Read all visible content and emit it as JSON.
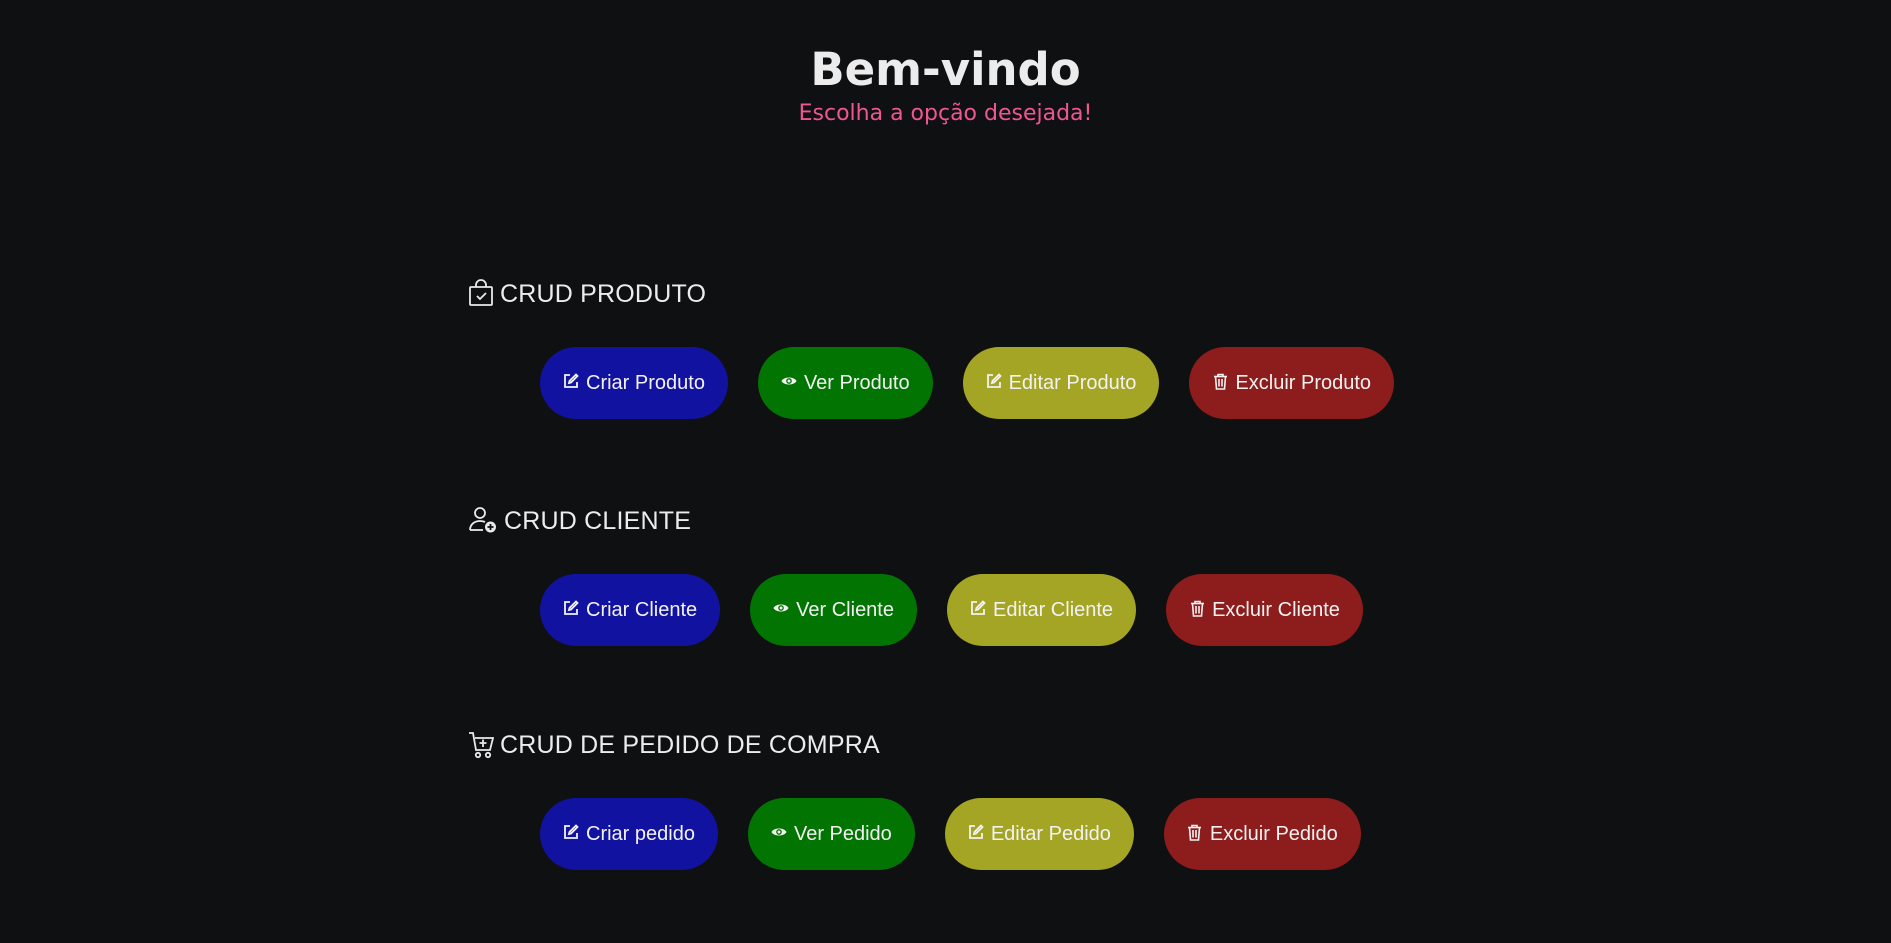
{
  "header": {
    "title": "Bem-vindo",
    "subtitle": "Escolha a opção desejada!"
  },
  "sections": [
    {
      "title": "CRUD PRODUTO",
      "icon": "shopping-bag-check-icon",
      "buttons": [
        {
          "label": "Criar Produto",
          "icon": "edit-icon",
          "color": "#1212a0"
        },
        {
          "label": "Ver Produto",
          "icon": "eye-icon",
          "color": "#027402"
        },
        {
          "label": "Editar Produto",
          "icon": "edit-icon",
          "color": "#a4a525"
        },
        {
          "label": "Excluir Produto",
          "icon": "trash-icon",
          "color": "#8d1c1c"
        }
      ]
    },
    {
      "title": "CRUD CLIENTE",
      "icon": "person-add-icon",
      "buttons": [
        {
          "label": "Criar Cliente",
          "icon": "edit-icon",
          "color": "#1212a0"
        },
        {
          "label": "Ver Cliente",
          "icon": "eye-icon",
          "color": "#027402"
        },
        {
          "label": "Editar Cliente",
          "icon": "edit-icon",
          "color": "#a4a525"
        },
        {
          "label": "Excluir Cliente",
          "icon": "trash-icon",
          "color": "#8d1c1c"
        }
      ]
    },
    {
      "title": "CRUD DE PEDIDO DE COMPRA",
      "icon": "cart-plus-icon",
      "buttons": [
        {
          "label": "Criar pedido",
          "icon": "edit-icon",
          "color": "#1212a0"
        },
        {
          "label": "Ver Pedido",
          "icon": "eye-icon",
          "color": "#027402"
        },
        {
          "label": "Editar Pedido",
          "icon": "edit-icon",
          "color": "#a4a525"
        },
        {
          "label": "Excluir Pedido",
          "icon": "trash-icon",
          "color": "#8d1c1c"
        }
      ]
    }
  ],
  "colors": {
    "background": "#0f1012",
    "accent_pink": "#f0568f"
  }
}
